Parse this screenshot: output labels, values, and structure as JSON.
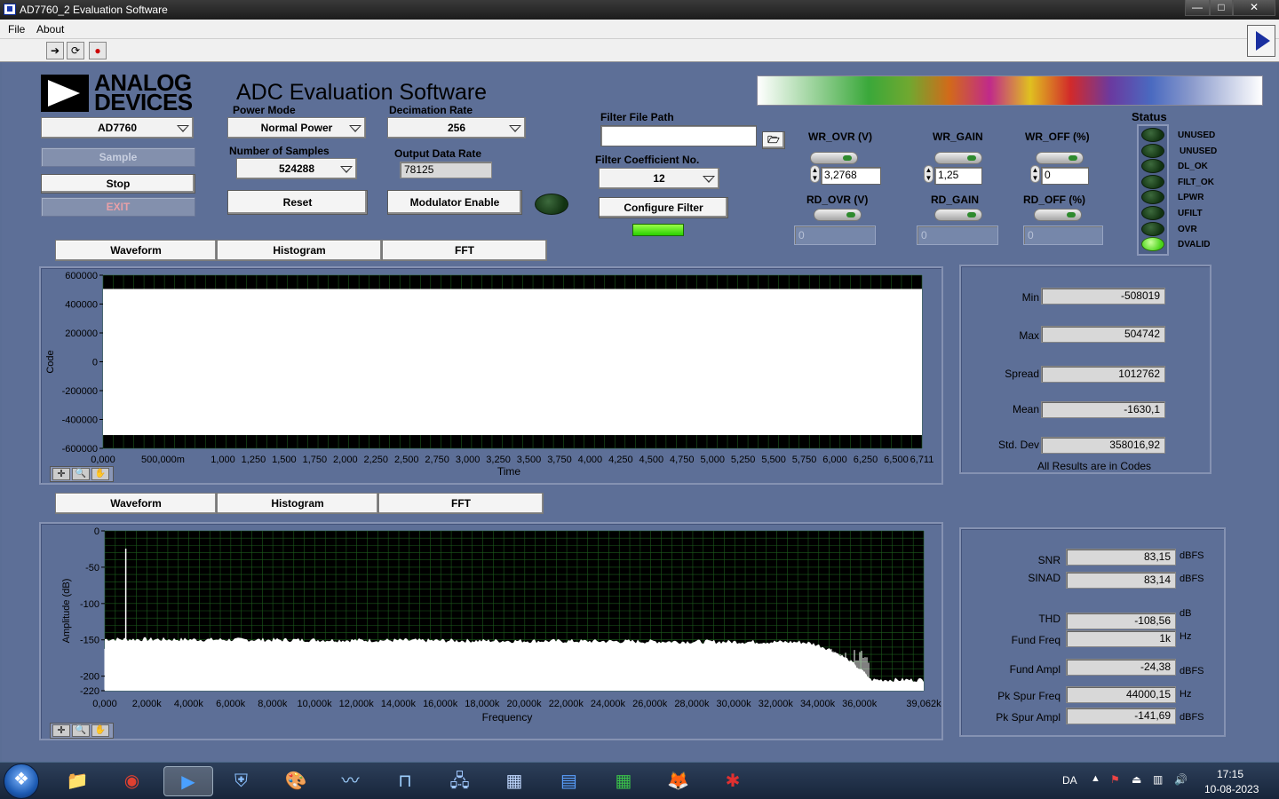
{
  "window": {
    "title": "AD7760_2 Evaluation Software",
    "minimize": "—",
    "maximize": "□",
    "close": "✕"
  },
  "menu": {
    "file": "File",
    "about": "About"
  },
  "toolbar": {
    "run_icon": "run-continuous-icon",
    "abort_icon": "abort-icon",
    "stop_icon": "stop-icon"
  },
  "header": {
    "logo_line1": "ANALOG",
    "logo_line2": "DEVICES",
    "app_title": "ADC Evaluation Software"
  },
  "controls": {
    "device": "AD7760",
    "power_mode_label": "Power Mode",
    "power_mode": "Normal Power",
    "decimation_label": "Decimation Rate",
    "decimation": "256",
    "samples_label": "Number of Samples",
    "samples": "524288",
    "odr_label": "Output Data Rate",
    "odr": "78125",
    "sample_btn": "Sample",
    "stop_btn": "Stop",
    "exit_btn": "EXIT",
    "reset_btn": "Reset",
    "modulator_btn": "Modulator Enable",
    "filter_path_label": "Filter File Path",
    "filter_path": "",
    "filter_coef_label": "Filter Coefficient No.",
    "filter_coef": "12",
    "configure_btn": "Configure Filter"
  },
  "registers": {
    "wr_ovr_label": "WR_OVR (V)",
    "wr_ovr": "3,2768",
    "wr_gain_label": "WR_GAIN",
    "wr_gain": "1,25",
    "wr_off_label": "WR_OFF (%)",
    "wr_off": "0",
    "rd_ovr_label": "RD_OVR (V)",
    "rd_ovr": "0",
    "rd_gain_label": "RD_GAIN",
    "rd_gain": "0",
    "rd_off_label": "RD_OFF (%)",
    "rd_off": "0"
  },
  "status": {
    "title": "Status",
    "items": [
      {
        "label": "UNUSED",
        "on": false
      },
      {
        "label": "UNUSED",
        "on": false
      },
      {
        "label": "DL_OK",
        "on": false
      },
      {
        "label": "FILT_OK",
        "on": false
      },
      {
        "label": "LPWR",
        "on": false
      },
      {
        "label": "UFILT",
        "on": false
      },
      {
        "label": "OVR",
        "on": false
      },
      {
        "label": "DVALID",
        "on": true
      }
    ]
  },
  "tabs_top": [
    "Waveform",
    "Histogram",
    "FFT"
  ],
  "tabs_bottom": [
    "Waveform",
    "Histogram",
    "FFT"
  ],
  "waveform": {
    "ylabel": "Code",
    "xlabel": "Time",
    "yticks": [
      "600000",
      "400000",
      "200000",
      "0",
      "-200000",
      "-400000",
      "-600000"
    ],
    "xticks": [
      "0,000",
      "500,000m",
      "1,000",
      "1,250",
      "1,500",
      "1,750",
      "2,000",
      "2,250",
      "2,500",
      "2,750",
      "3,000",
      "3,250",
      "3,500",
      "3,750",
      "4,000",
      "4,250",
      "4,500",
      "4,750",
      "5,000",
      "5,250",
      "5,500",
      "5,750",
      "6,000",
      "6,250",
      "6,500",
      "6,711"
    ]
  },
  "stats": {
    "min_label": "Min",
    "min": "-508019",
    "max_label": "Max",
    "max": "504742",
    "spread_label": "Spread",
    "spread": "1012762",
    "mean_label": "Mean",
    "mean": "-1630,1",
    "std_label": "Std. Dev",
    "std": "358016,92",
    "note": "All Results are in Codes"
  },
  "fft": {
    "ylabel": "Amplitude (dB)",
    "xlabel": "Frequency",
    "yticks": [
      "0",
      "-50",
      "-100",
      "-150",
      "-200",
      "-220"
    ],
    "xticks": [
      "0,000",
      "2,000k",
      "4,000k",
      "6,000k",
      "8,000k",
      "10,000k",
      "12,000k",
      "14,000k",
      "16,000k",
      "18,000k",
      "20,000k",
      "22,000k",
      "24,000k",
      "26,000k",
      "28,000k",
      "30,000k",
      "32,000k",
      "34,000k",
      "36,000k",
      "39,062k"
    ]
  },
  "chart_data": [
    {
      "type": "line",
      "xlabel": "Time",
      "ylabel": "Code",
      "xlim": [
        0,
        6.711
      ],
      "ylim": [
        -600000,
        600000
      ],
      "series_envelope": {
        "max": 504742,
        "min": -508019
      },
      "grid": true
    },
    {
      "type": "line",
      "xlabel": "Frequency",
      "ylabel": "Amplitude (dB)",
      "xlim": [
        0,
        39062
      ],
      "ylim": [
        -220,
        0
      ],
      "x": [
        0,
        1000,
        2000,
        10000,
        20000,
        30000,
        33000,
        35000,
        36500,
        39062
      ],
      "y": [
        -150,
        -24.38,
        -155,
        -153,
        -153,
        -155,
        -158,
        -175,
        -205,
        -210
      ],
      "grid": true
    }
  ],
  "fft_results": {
    "snr_label": "SNR",
    "snr": "83,15",
    "snr_unit": "dBFS",
    "sinad_label": "SINAD",
    "sinad": "83,14",
    "sinad_unit": "dBFS",
    "thd_label": "THD",
    "thd": "-108,56",
    "thd_unit": "dB",
    "fund_freq_label": "Fund Freq",
    "fund_freq": "1k",
    "fund_freq_unit": "Hz",
    "fund_ampl_label": "Fund Ampl",
    "fund_ampl": "-24,38",
    "fund_ampl_unit": "dBFS",
    "spur_freq_label": "Pk Spur Freq",
    "spur_freq": "44000,15",
    "spur_freq_unit": "Hz",
    "spur_ampl_label": "Pk Spur Ampl",
    "spur_ampl": "-141,69",
    "spur_ampl_unit": "dBFS"
  },
  "taskbar": {
    "lang": "DA",
    "time": "17:15",
    "date": "10-08-2023",
    "apps": [
      "windows-start-icon",
      "file-explorer-icon",
      "chrome-icon",
      "labview-app-icon",
      "network-admin-icon",
      "paint-icon",
      "oscilloscope-icon",
      "waveform-gen-icon",
      "network-icon",
      "calculator-icon",
      "writer-icon",
      "calc-sheet-icon",
      "fox-icon",
      "bug-icon"
    ]
  }
}
